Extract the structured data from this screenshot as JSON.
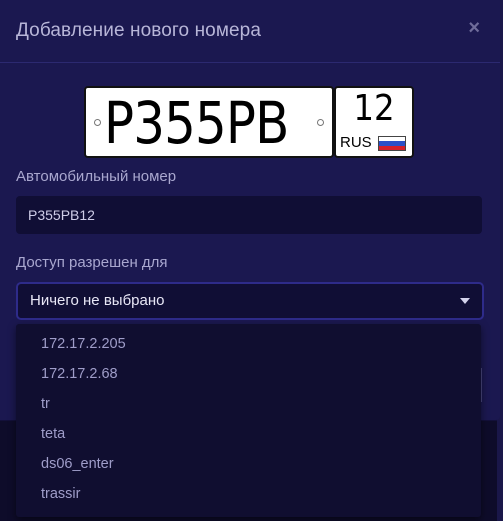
{
  "dialog": {
    "title": "Добавление нового номера",
    "close_icon": "×"
  },
  "plate": {
    "number": "Р355РВ",
    "region": "12",
    "country": "RUS",
    "flag_colors": [
      "#ffffff",
      "#2b50c8",
      "#d4202a"
    ]
  },
  "form": {
    "plate_label": "Автомобильный номер",
    "plate_value": "Р355РВ12",
    "access_label": "Доступ разрешен для",
    "access_selected": "Ничего не выбрано"
  },
  "dropdown": {
    "options": [
      "172.17.2.205",
      "172.17.2.68",
      "tr",
      "teta",
      "ds06_enter",
      "trassir"
    ]
  }
}
